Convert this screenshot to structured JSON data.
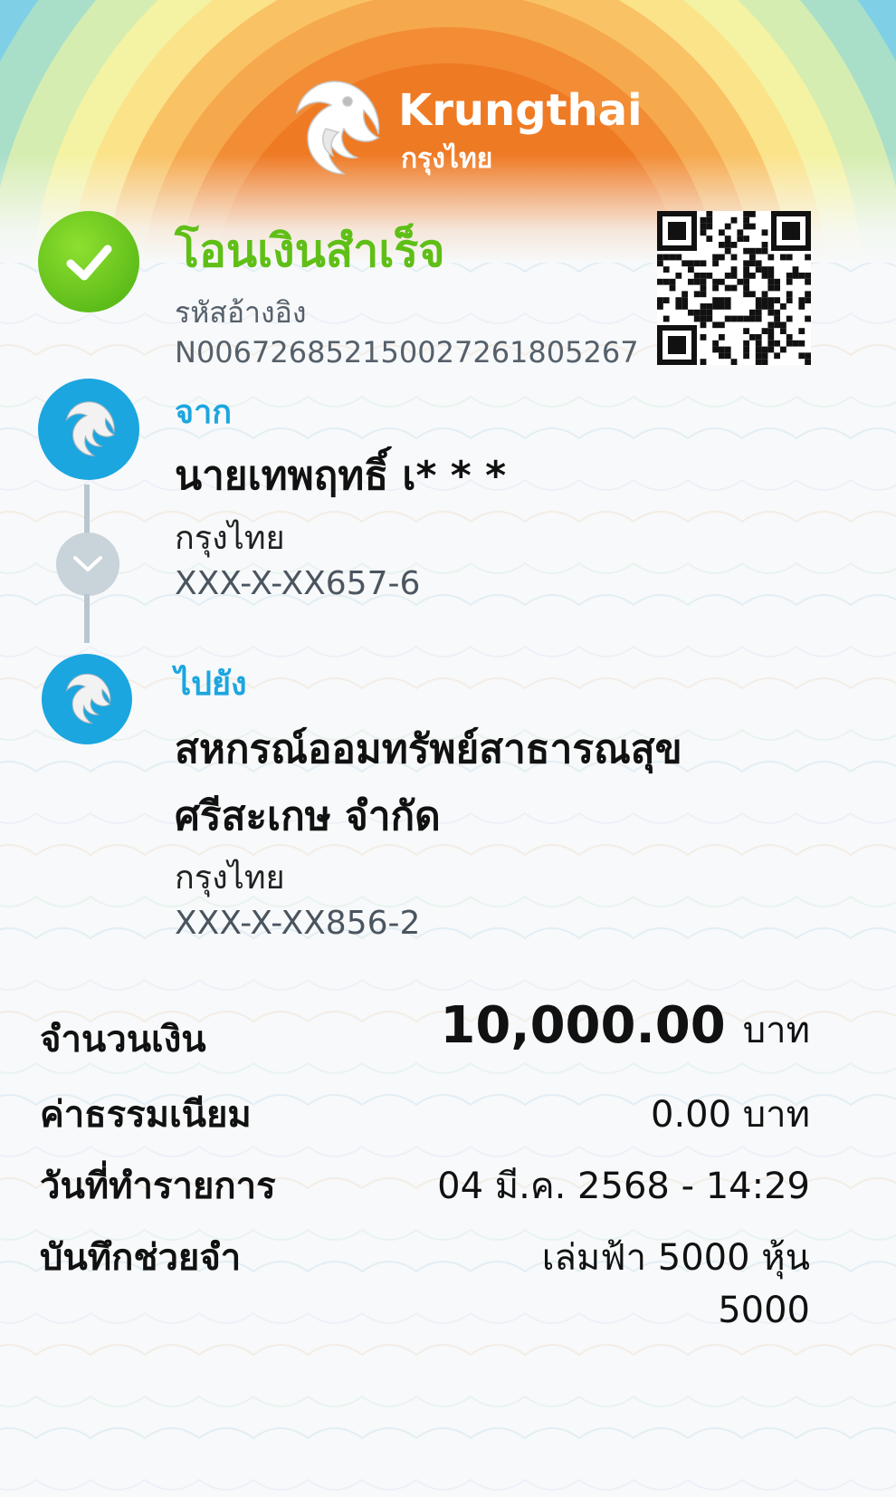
{
  "brand": {
    "name_en": "Krungthai",
    "name_th": "กรุงไทย",
    "colors": {
      "success": "#5fbf16",
      "accent_blue": "#1ba6e0",
      "hero_orange": "#ef7a24"
    }
  },
  "status": {
    "title": "โอนเงินสำเร็จ",
    "ref_label": "รหัสอ้างอิง",
    "ref_number": "N006726852150027261805267",
    "icons": {
      "status": "check-icon",
      "qr": "qr-code-icon"
    }
  },
  "from": {
    "label": "จาก",
    "name": "นายเทพฤทธิ์ เ* * *",
    "bank": "กรุงไทย",
    "account": "XXX-X-XX657-6"
  },
  "to": {
    "label": "ไปยัง",
    "name_line1": "สหกรณ์ออมทรัพย์สาธารณสุข",
    "name_line2": "ศรีสะเกษ จำกัด",
    "bank": "กรุงไทย",
    "account": "XXX-X-XX856-2"
  },
  "details": {
    "amount_label": "จำนวนเงิน",
    "amount_value": "10,000.00",
    "amount_unit": "บาท",
    "fee_label": "ค่าธรรมเนียม",
    "fee_value": "0.00 บาท",
    "date_label": "วันที่ทำรายการ",
    "date_value": "04 มี.ค. 2568 - 14:29",
    "memo_label": "บันทึกช่วยจำ",
    "memo_line1": "เล่มฟ้า 5000 หุ้น",
    "memo_line2": "5000"
  }
}
